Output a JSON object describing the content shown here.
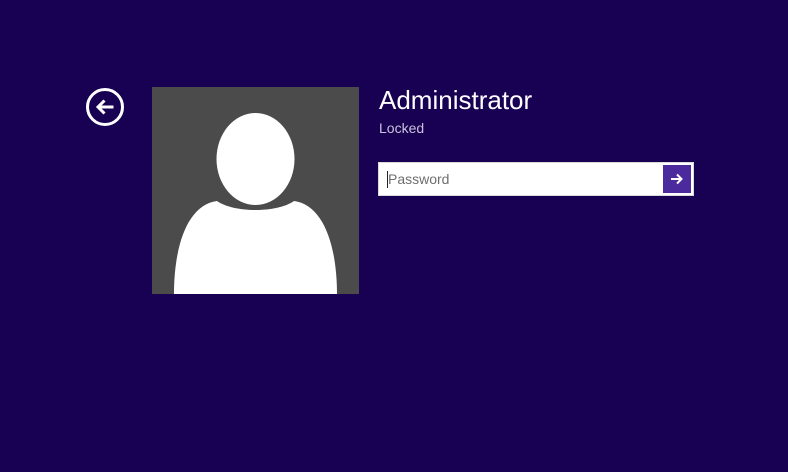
{
  "colors": {
    "background": "#180052",
    "avatar_tile": "#4b4b4b",
    "submit_button": "#4b2a9d",
    "text_primary": "#ffffff",
    "text_secondary": "#c9c3dc"
  },
  "icons": {
    "back": "back-arrow-icon",
    "submit": "arrow-right-icon",
    "avatar": "user-silhouette-icon"
  },
  "user": {
    "name": "Administrator",
    "status": "Locked"
  },
  "password": {
    "placeholder": "Password",
    "value": ""
  }
}
